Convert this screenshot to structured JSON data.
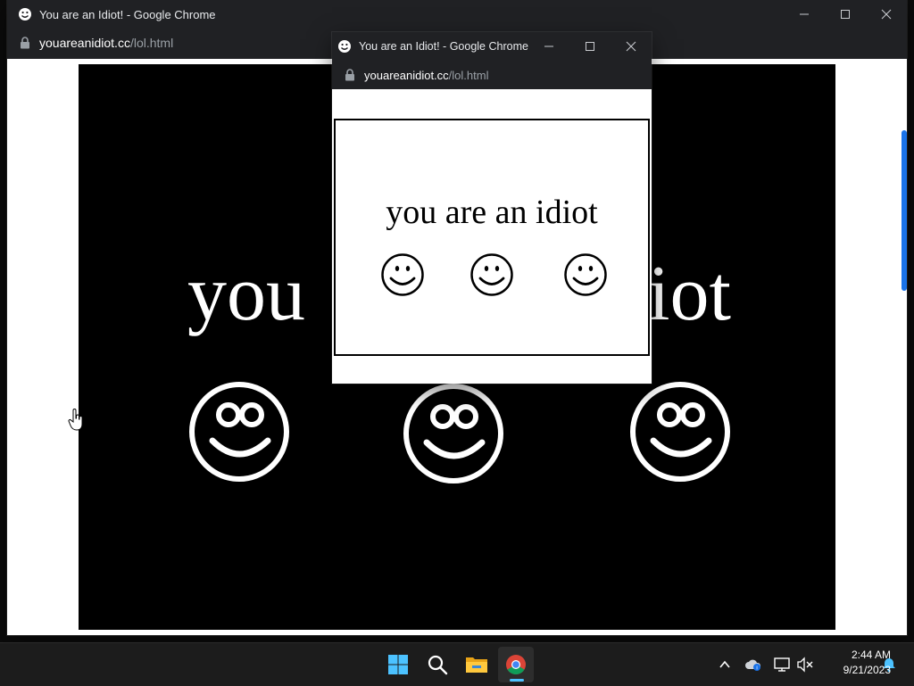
{
  "main_window": {
    "title": "You are an Idiot! - Google Chrome",
    "url_host": "youareanidiot.cc",
    "url_path": "/lol.html",
    "big_text_left": "you",
    "big_text_right": "iot"
  },
  "popup_window": {
    "title": "You are an Idiot! - Google Chrome",
    "url_host": "youareanidiot.cc",
    "url_path": "/lol.html",
    "message": "you are an idiot"
  },
  "taskbar": {
    "time": "2:44 AM",
    "date": "9/21/2023"
  },
  "icons": {
    "window_icon": "smiley-icon",
    "lock": "lock-icon",
    "minimize": "minimize-icon",
    "maximize": "maximize-icon",
    "close": "close-icon",
    "start": "windows-start-icon",
    "search": "search-icon",
    "explorer": "file-explorer-icon",
    "chrome": "chrome-icon",
    "tray_chevron": "chevron-up-icon",
    "onedrive": "cloud-icon",
    "network": "network-icon",
    "volume": "volume-muted-icon",
    "notifications": "bell-icon"
  },
  "colors": {
    "chrome_dark": "#202124",
    "taskbar": "#1c1c1c",
    "accent": "#4cc2ff"
  }
}
